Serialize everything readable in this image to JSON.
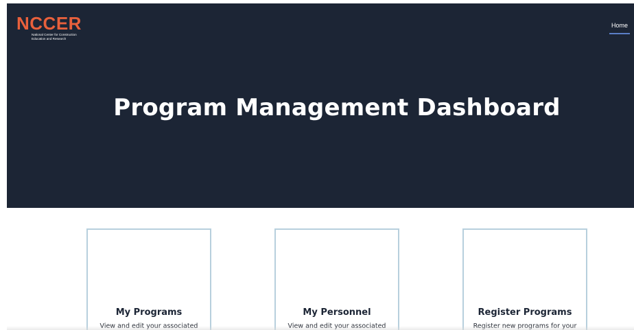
{
  "header": {
    "logo": {
      "wordmark": "NCCER",
      "tagline_line1": "National Center for Construction",
      "tagline_line2": "Education and Research"
    },
    "nav": {
      "home_label": "Home"
    }
  },
  "hero": {
    "title": "Program Management Dashboard"
  },
  "cards": [
    {
      "title": "My Programs",
      "description": "View and edit your associated"
    },
    {
      "title": "My Personnel",
      "description": "View and edit your associated"
    },
    {
      "title": "Register Programs",
      "description": "Register new programs for your"
    }
  ],
  "colors": {
    "hero_bg": "#1c2535",
    "brand_orange": "#e8603c",
    "card_border": "#b7cfdd",
    "nav_underline": "#5b7fc7"
  }
}
